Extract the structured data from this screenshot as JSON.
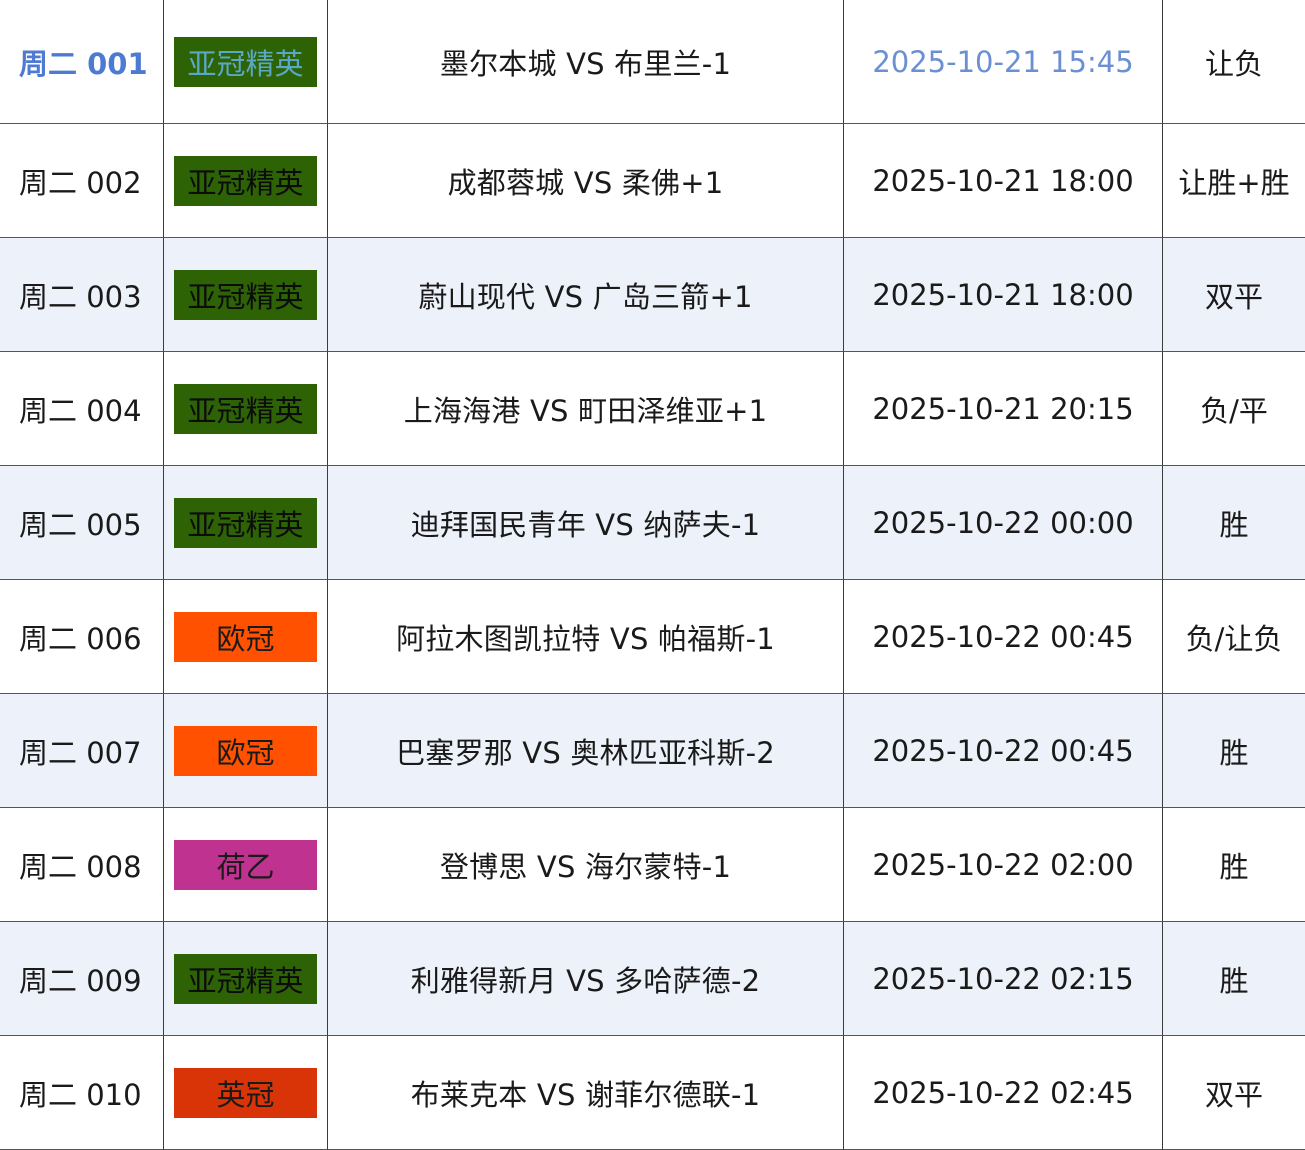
{
  "colors": {
    "highlight_blue": "#4e7bd1",
    "row_alt_background": "#edf1f9",
    "league_badges": {
      "亚冠精英": {
        "bg": "#2e6305",
        "fg": "#0c0c0c"
      },
      "欧冠": {
        "bg": "#ff5100",
        "fg": "#1a1a1a"
      },
      "荷乙": {
        "bg": "#c0328f",
        "fg": "#1a1a1a"
      },
      "英冠": {
        "bg": "#d93408",
        "fg": "#1a1a1a"
      }
    }
  },
  "rows": [
    {
      "code": "周二 001",
      "league": "亚冠精英",
      "match": "墨尔本城 VS 布里兰-1",
      "time": "2025-10-21 15:45",
      "pick": "让负",
      "highlight": true,
      "badge_text_color": "#5aa8c8"
    },
    {
      "code": "周二 002",
      "league": "亚冠精英",
      "match": "成都蓉城 VS 柔佛+1",
      "time": "2025-10-21 18:00",
      "pick": "让胜+胜"
    },
    {
      "code": "周二 003",
      "league": "亚冠精英",
      "match": "蔚山现代 VS 广岛三箭+1",
      "time": "2025-10-21 18:00",
      "pick": "双平"
    },
    {
      "code": "周二 004",
      "league": "亚冠精英",
      "match": "上海海港 VS 町田泽维亚+1",
      "time": "2025-10-21 20:15",
      "pick": "负/平"
    },
    {
      "code": "周二 005",
      "league": "亚冠精英",
      "match": "迪拜国民青年 VS 纳萨夫-1",
      "time": "2025-10-22 00:00",
      "pick": "胜"
    },
    {
      "code": "周二 006",
      "league": "欧冠",
      "match": "阿拉木图凯拉特 VS 帕福斯-1",
      "time": "2025-10-22 00:45",
      "pick": "负/让负"
    },
    {
      "code": "周二 007",
      "league": "欧冠",
      "match": "巴塞罗那 VS 奥林匹亚科斯-2",
      "time": "2025-10-22 00:45",
      "pick": "胜"
    },
    {
      "code": "周二 008",
      "league": "荷乙",
      "match": "登博思 VS 海尔蒙特-1",
      "time": "2025-10-22 02:00",
      "pick": "胜"
    },
    {
      "code": "周二 009",
      "league": "亚冠精英",
      "match": "利雅得新月 VS 多哈萨德-2",
      "time": "2025-10-22 02:15",
      "pick": "胜"
    },
    {
      "code": "周二 010",
      "league": "英冠",
      "match": "布莱克本 VS 谢菲尔德联-1",
      "time": "2025-10-22 02:45",
      "pick": "双平"
    }
  ]
}
